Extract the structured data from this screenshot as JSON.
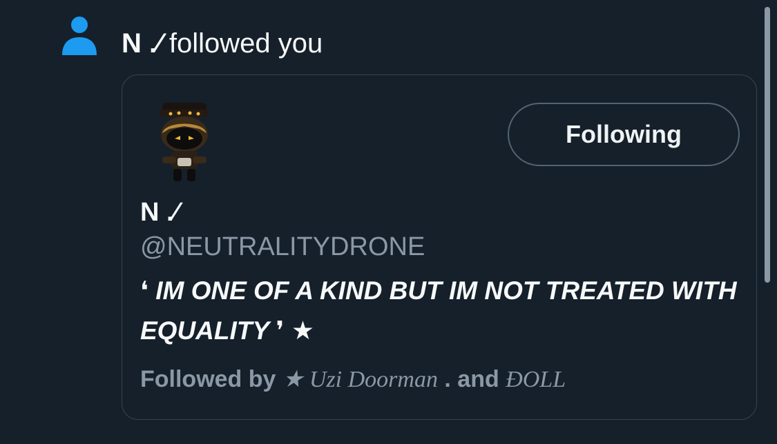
{
  "notification": {
    "icon": "person-icon",
    "actor": "N .⁄",
    "action": " followed you"
  },
  "profile": {
    "follow_button_label": "Following",
    "display_name": "N .⁄",
    "handle": "@NEUTRALITYDRONE",
    "bio": "❛ IM ONE OF A KIND BUT IM NOT TREATED WITH EQUALITY ❜ ★",
    "followed_by": {
      "label": "Followed by ",
      "first": "★ Uzi Doorman",
      "and": " . and ",
      "second": "ĐOLL"
    }
  },
  "colors": {
    "background": "#15202b",
    "icon_blue": "#1d9bf0",
    "muted_text": "#8b98a5",
    "border": "#38444d"
  }
}
